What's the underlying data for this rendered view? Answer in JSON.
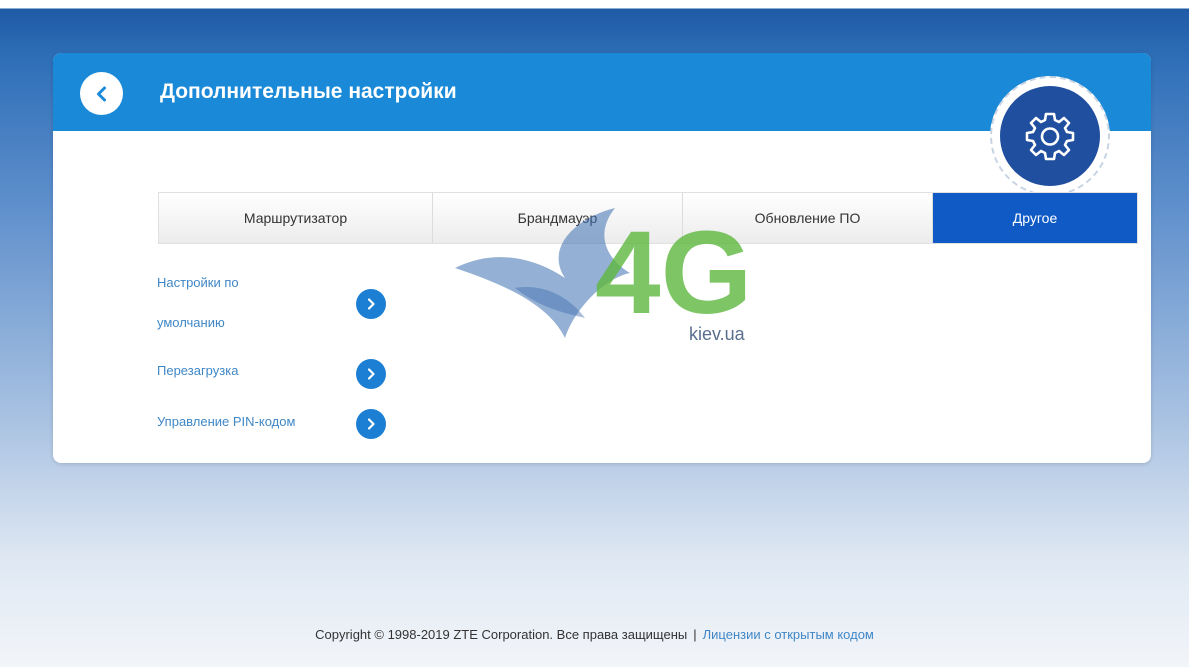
{
  "header": {
    "title": "Дополнительные настройки",
    "back_icon": "chevron-left-icon",
    "settings_icon": "gear-icon"
  },
  "tabs": [
    {
      "label": "Маршрутизатор",
      "active": false
    },
    {
      "label": "Брандмауэр",
      "active": false
    },
    {
      "label": "Обновление ПО",
      "active": false
    },
    {
      "label": "Другое",
      "active": true
    }
  ],
  "menu": {
    "items": [
      {
        "label_line1": "Настройки по",
        "label_line2": "умолчанию"
      },
      {
        "label": "Перезагрузка"
      },
      {
        "label": "Управление PIN-кодом"
      }
    ]
  },
  "watermark": {
    "logo_text": "4G",
    "domain": "kiev.ua"
  },
  "footer": {
    "copyright": "Copyright © 1998-2019 ZTE Corporation. Все права защищены",
    "separator": "|",
    "license_link": "Лицензии с открытым кодом"
  },
  "colors": {
    "header_blue": "#1a8ad8",
    "active_tab": "#0f5ac4",
    "link_blue": "#3f87c6",
    "arrow_blue": "#1c7fd3",
    "gear_badge": "#1f4f9e"
  }
}
